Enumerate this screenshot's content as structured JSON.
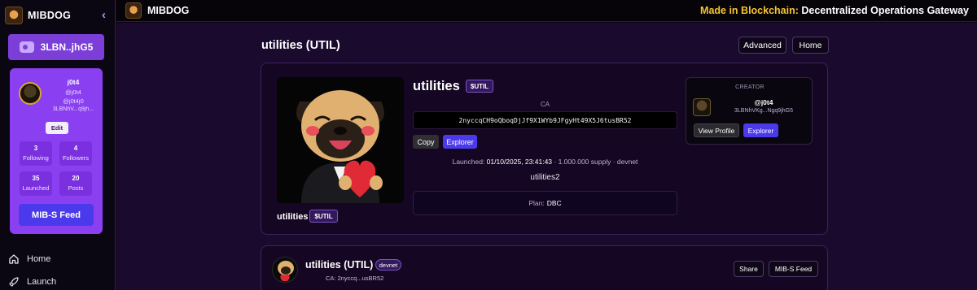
{
  "sidebar": {
    "brand": "MIBDOG",
    "collapse_glyph": "‹",
    "wallet_label": "3LBN..jhG5",
    "profile": {
      "name": "j0t4",
      "handle": "@j0t4",
      "handle_alt": "@j0t4j0",
      "address": "3LBNhV...q9jh...",
      "edit_label": "Edit",
      "stats": [
        {
          "value": "3",
          "label": "Following"
        },
        {
          "value": "4",
          "label": "Followers"
        },
        {
          "value": "35",
          "label": "Launched"
        },
        {
          "value": "20",
          "label": "Posts"
        }
      ],
      "feed_button": "MIB-S Feed"
    },
    "nav": [
      {
        "label": "Home",
        "icon": "home-icon"
      },
      {
        "label": "Launch",
        "icon": "rocket-icon"
      }
    ]
  },
  "topbar": {
    "brand": "MIBDOG",
    "tagline_highlight": "Made in Blockchain:",
    "tagline_rest": " Decentralized Operations Gateway"
  },
  "page": {
    "title": "utilities (UTIL)",
    "advanced_label": "Advanced",
    "home_label": "Home"
  },
  "token": {
    "image_caption": "utilities",
    "image_badge": "$UTIL",
    "name": "utilities",
    "ticker_badge": "$UTIL",
    "ca_label": "CA",
    "contract_address": "2nyccqCH9oQboqDjJf9X1WYb9JFgyHt49X5J6tusBR52",
    "copy_label": "Copy",
    "explorer_label": "Explorer",
    "launched_prefix": "Launched: ",
    "launched_date": "01/10/2025, 23:41:43",
    "launched_suffix": " · 1.000.000 supply · devnet",
    "description": "utilities2",
    "plan_label": "Plan:",
    "plan_value": "DBC"
  },
  "creator": {
    "title": "CREATOR",
    "handle": "@j0t4",
    "address": "3LBNhVKg...Ngq9jhG5",
    "view_profile_label": "View Profile",
    "explorer_label": "Explorer"
  },
  "post": {
    "title": "utilities (UTIL)",
    "network_badge": "devnet",
    "ca_short": "CA: 2nyccq...usBR52",
    "share_label": "Share",
    "feed_label": "MIB-S Feed"
  },
  "colors": {
    "accent_purple": "#8a3ff0",
    "button_blue": "#4b3aeb",
    "gold_text": "#f4c431",
    "background": "#190a2e"
  }
}
